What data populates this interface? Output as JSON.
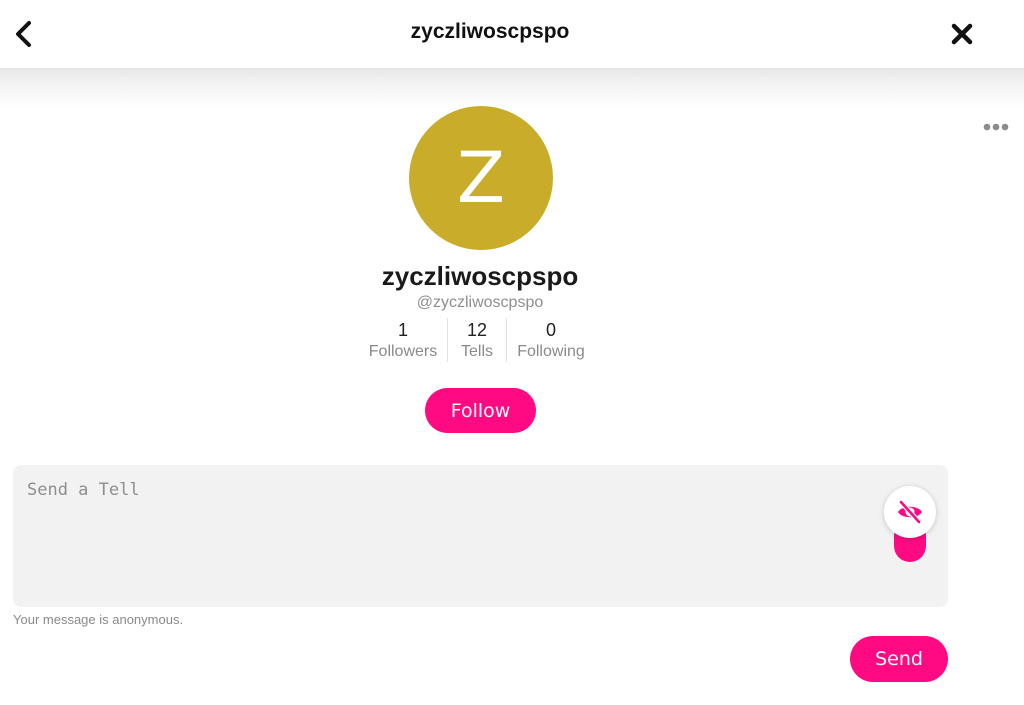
{
  "header": {
    "title": "zyczliwoscpspo",
    "back_icon": "chevron-left-icon",
    "close_icon": "close-icon"
  },
  "profile": {
    "avatar_letter": "Z",
    "avatar_color": "#c9ac29",
    "display_name": "zyczliwoscpspo",
    "handle": "@zyczliwoscpspo",
    "more_icon": "more-horizontal-icon",
    "stats": [
      {
        "value": "1",
        "label": "Followers"
      },
      {
        "value": "12",
        "label": "Tells"
      },
      {
        "value": "0",
        "label": "Following"
      }
    ],
    "follow_label": "Follow"
  },
  "compose": {
    "placeholder": "Send a Tell",
    "value": "",
    "anonymous_toggle_icon": "eye-off-icon",
    "anonymous_on": true,
    "anonymous_note": "Your message is anonymous.",
    "send_label": "Send"
  },
  "colors": {
    "accent": "#ff0a82",
    "avatar": "#c9ac29"
  }
}
